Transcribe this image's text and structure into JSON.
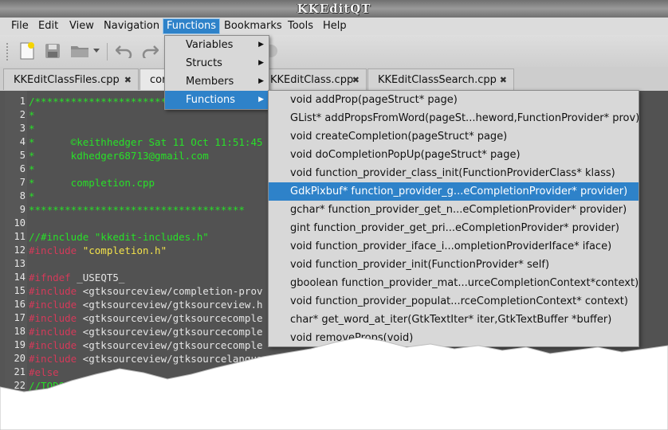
{
  "window": {
    "title": "KKEditQT"
  },
  "menubar": [
    {
      "label": "File"
    },
    {
      "label": "Edit"
    },
    {
      "label": "View"
    },
    {
      "label": "Navigation"
    },
    {
      "label": "Functions"
    },
    {
      "label": "Bookmarks"
    },
    {
      "label": "Tools"
    },
    {
      "label": "Help"
    }
  ],
  "toolbar": {
    "icons": [
      "new-document-icon",
      "save-icon",
      "open-folder-icon",
      "dropdown-arrow-icon",
      "undo-icon",
      "redo-icon"
    ]
  },
  "tabs": [
    {
      "label": "KKEditClassFiles.cpp",
      "close": "✖"
    },
    {
      "label": "completion.cpp",
      "close": "✖"
    },
    {
      "label": "KKEditClass.cpp",
      "close": "✖"
    },
    {
      "label": "KKEditClassSearch.cpp",
      "close": "✖"
    }
  ],
  "functions_menu": {
    "items": [
      {
        "label": "Variables"
      },
      {
        "label": "Structs"
      },
      {
        "label": "Members"
      },
      {
        "label": "Functions"
      }
    ]
  },
  "functions_submenu": {
    "items": [
      "void addProp(pageStruct* page)",
      "GList* addPropsFromWord(pageSt...heword,FunctionProvider* prov)",
      "void createCompletion(pageStruct* page)",
      "void doCompletionPopUp(pageStruct* page)",
      "void function_provider_class_init(FunctionProviderClass* klass)",
      "GdkPixbuf* function_provider_g...eCompletionProvider* provider)",
      "gchar* function_provider_get_n...eCompletionProvider* provider)",
      "gint function_provider_get_pri...eCompletionProvider* provider)",
      "void function_provider_iface_i...ompletionProviderIface* iface)",
      "void function_provider_init(FunctionProvider* self)",
      "gboolean function_provider_mat...urceCompletionContext*context)",
      "void function_provider_populat...rceCompletionContext* context)",
      "char* get_word_at_iter(GtkTextIter* iter,GtkTextBuffer *buffer)",
      "void removeProps(void)"
    ],
    "highlighted_index": 5
  },
  "editor": {
    "line_numbers": [
      "1",
      "2",
      "3",
      "4",
      "5",
      "6",
      "7",
      "8",
      "9",
      "10",
      "11",
      "12",
      "13",
      "14",
      "15",
      "16",
      "17",
      "18",
      "19",
      "20",
      "21",
      "22"
    ],
    "lines": [
      [
        {
          "t": "/************************",
          "c": "green"
        }
      ],
      [
        {
          "t": "*",
          "c": "green"
        }
      ],
      [
        {
          "t": "*",
          "c": "green"
        }
      ],
      [
        {
          "t": "*      ©keithhedger Sat 11 Oct 11:51:45",
          "c": "green"
        }
      ],
      [
        {
          "t": "*      kdhedger68713@gmail.com",
          "c": "green"
        }
      ],
      [
        {
          "t": "*",
          "c": "green"
        }
      ],
      [
        {
          "t": "*      completion.cpp",
          "c": "green"
        }
      ],
      [
        {
          "t": "*",
          "c": "green"
        }
      ],
      [
        {
          "t": "************************************",
          "c": "green"
        }
      ],
      [],
      [
        {
          "t": "//#include \"kkedit-includes.h\"",
          "c": "green"
        }
      ],
      [
        {
          "t": "#include ",
          "c": "red"
        },
        {
          "t": "\"completion.h\"",
          "c": "yellow"
        }
      ],
      [],
      [
        {
          "t": "#ifndef ",
          "c": "red"
        },
        {
          "t": "_USEQT5_",
          "c": "white"
        }
      ],
      [
        {
          "t": "#include ",
          "c": "red"
        },
        {
          "t": "<gtksourceview/completion-prov",
          "c": "white"
        }
      ],
      [
        {
          "t": "#include ",
          "c": "red"
        },
        {
          "t": "<gtksourceview/gtksourceview.h",
          "c": "white"
        }
      ],
      [
        {
          "t": "#include ",
          "c": "red"
        },
        {
          "t": "<gtksourceview/gtksourcecomple",
          "c": "white"
        }
      ],
      [
        {
          "t": "#include ",
          "c": "red"
        },
        {
          "t": "<gtksourceview/gtksourcecomple",
          "c": "white"
        }
      ],
      [
        {
          "t": "#include ",
          "c": "red"
        },
        {
          "t": "<gtksourceview/gtksourcecomple",
          "c": "white"
        }
      ],
      [
        {
          "t": "#include ",
          "c": "red"
        },
        {
          "t": "<gtksourceview/gtksourcelanguagemanager.h>",
          "c": "white"
        }
      ],
      [
        {
          "t": "#else",
          "c": "red"
        }
      ],
      [
        {
          "t": "//TODO//",
          "c": "green"
        }
      ]
    ]
  },
  "colors": {
    "accent": "#2e82c9",
    "editor_bg": "#525252",
    "comment": "#28e028",
    "preprocessor": "#d43a5a",
    "string": "#f3e24a"
  }
}
